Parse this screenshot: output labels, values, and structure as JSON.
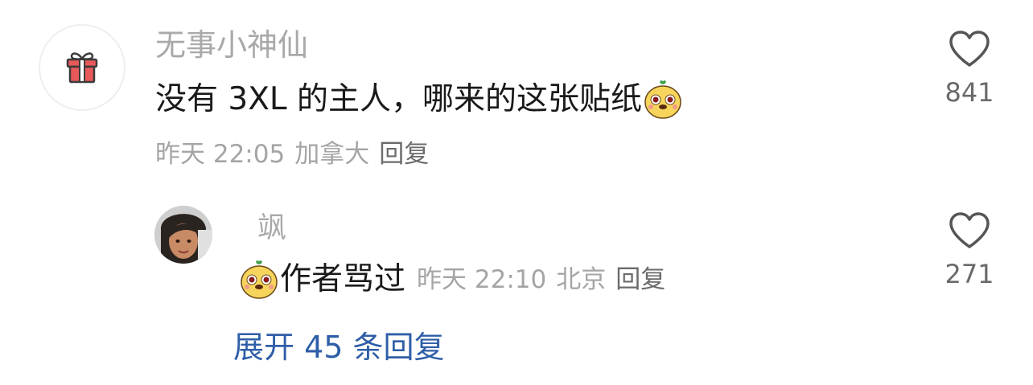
{
  "comment": {
    "username": "无事小神仙",
    "text": "没有 3XL 的主人，哪来的这张贴纸",
    "sticker": "cartoon-face-sticker",
    "time": "昨天 22:05",
    "location": "加拿大",
    "reply_label": "回复",
    "likes": "841"
  },
  "reply": {
    "username": "飒",
    "sticker": "cartoon-face-sticker",
    "text": "作者骂过",
    "time": "昨天 22:10",
    "location": "北京",
    "reply_label": "回复",
    "likes": "271"
  },
  "expand_label": "展开 45 条回复",
  "colors": {
    "username": "#a9a9a9",
    "text": "#1a1a1a",
    "link": "#2f5ea8",
    "gift_red": "#e8595a"
  }
}
